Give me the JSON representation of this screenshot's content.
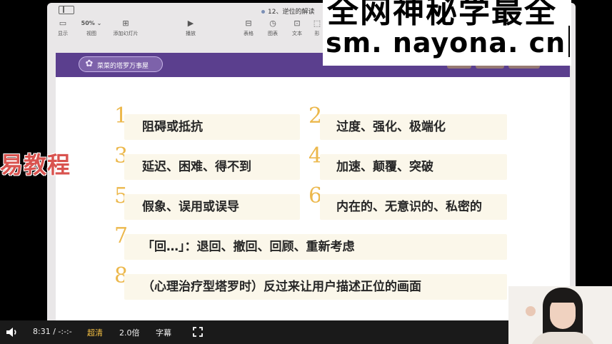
{
  "app": {
    "doc_title": "12、逆位的解读",
    "toolbar": [
      {
        "icon": "sidebar-panel-icon",
        "glyph": "▭",
        "label": "显示"
      },
      {
        "icon": "zoom-value",
        "glyph": "50% ⌄",
        "label": "视图"
      },
      {
        "icon": "add-slide-icon",
        "glyph": "⊞",
        "label": "添加幻灯片"
      },
      {
        "icon": "play-icon",
        "glyph": "▶",
        "label": "播放"
      },
      {
        "icon": "table-icon",
        "glyph": "⊟",
        "label": "表格"
      },
      {
        "icon": "chart-icon",
        "glyph": "◷",
        "label": "图表"
      },
      {
        "icon": "text-icon",
        "glyph": "⊡",
        "label": "文本"
      },
      {
        "icon": "shape-icon",
        "glyph": "⬚",
        "label": "形"
      }
    ]
  },
  "slide": {
    "banner_logo_text": "菜菜的塔罗万事屋",
    "items": [
      {
        "num": "1",
        "text": "阻碍或抵抗"
      },
      {
        "num": "2",
        "text": "过度、强化、极端化"
      },
      {
        "num": "3",
        "text": "延迟、困难、得不到"
      },
      {
        "num": "4",
        "text": "加速、颠覆、突破"
      },
      {
        "num": "5",
        "text": "假象、误用或误导"
      },
      {
        "num": "6",
        "text": "内在的、无意识的、私密的"
      },
      {
        "num": "7",
        "text": "「回…」：退回、撤回、回顾、重新考虑"
      },
      {
        "num": "8",
        "text": "（心理治疗型塔罗时）反过来让用户描述正位的画面"
      }
    ]
  },
  "watermark": {
    "line1": "全网神秘学最全",
    "line2": "sm. nayona. cn"
  },
  "side_overlay_text": "易教程",
  "player": {
    "time": "8:31 / -:-:-",
    "quality": "超清",
    "speed": "2.0倍",
    "subtitles": "字幕"
  },
  "colors": {
    "banner": "#5b3f8e",
    "number": "#ecb84c",
    "pill": "#fbf7ea",
    "player_bg": "#1a1a1a",
    "quality_highlight": "#f6c143"
  }
}
